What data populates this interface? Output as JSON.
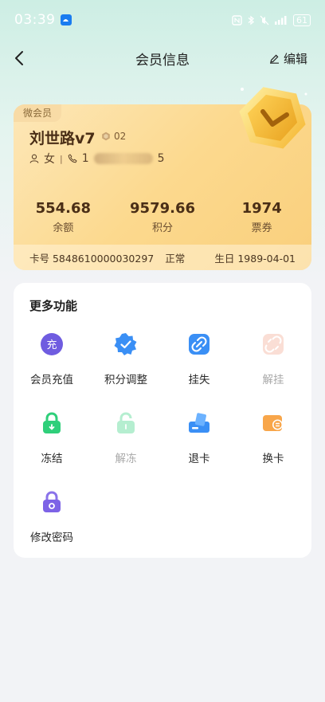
{
  "status": {
    "time": "03:39",
    "battery": "61"
  },
  "nav": {
    "title": "会员信息",
    "edit_label": "编辑"
  },
  "card": {
    "tag": "微会员",
    "name": "刘世路v7",
    "level": "02",
    "gender": "女",
    "phone_prefix": "1",
    "phone_suffix": "5",
    "stats": [
      {
        "value": "554.68",
        "label": "余额"
      },
      {
        "value": "9579.66",
        "label": "积分"
      },
      {
        "value": "1974",
        "label": "票券"
      }
    ],
    "card_no": "卡号 5848610000030297",
    "state": "正常",
    "birthday": "生日 1989-04-01"
  },
  "panel": {
    "title": "更多功能",
    "functions": [
      {
        "label": "会员充值",
        "icon": "recharge-icon",
        "enabled": true
      },
      {
        "label": "积分调整",
        "icon": "points-adjust-icon",
        "enabled": true
      },
      {
        "label": "挂失",
        "icon": "link-icon",
        "enabled": true
      },
      {
        "label": "解挂",
        "icon": "unlink-icon",
        "enabled": false
      },
      {
        "label": "冻结",
        "icon": "lock-icon",
        "enabled": true
      },
      {
        "label": "解冻",
        "icon": "unlock-icon",
        "enabled": false
      },
      {
        "label": "退卡",
        "icon": "return-card-icon",
        "enabled": true
      },
      {
        "label": "换卡",
        "icon": "swap-card-icon",
        "enabled": true
      },
      {
        "label": "修改密码",
        "icon": "password-lock-icon",
        "enabled": true
      }
    ]
  },
  "colors": {
    "accent": "#4a2e16",
    "card_gold": "#fcd98e",
    "recharge": "#6f5ce0",
    "green": "#2fcf7a",
    "blue": "#3a8ff5",
    "orange": "#f8a64a"
  }
}
